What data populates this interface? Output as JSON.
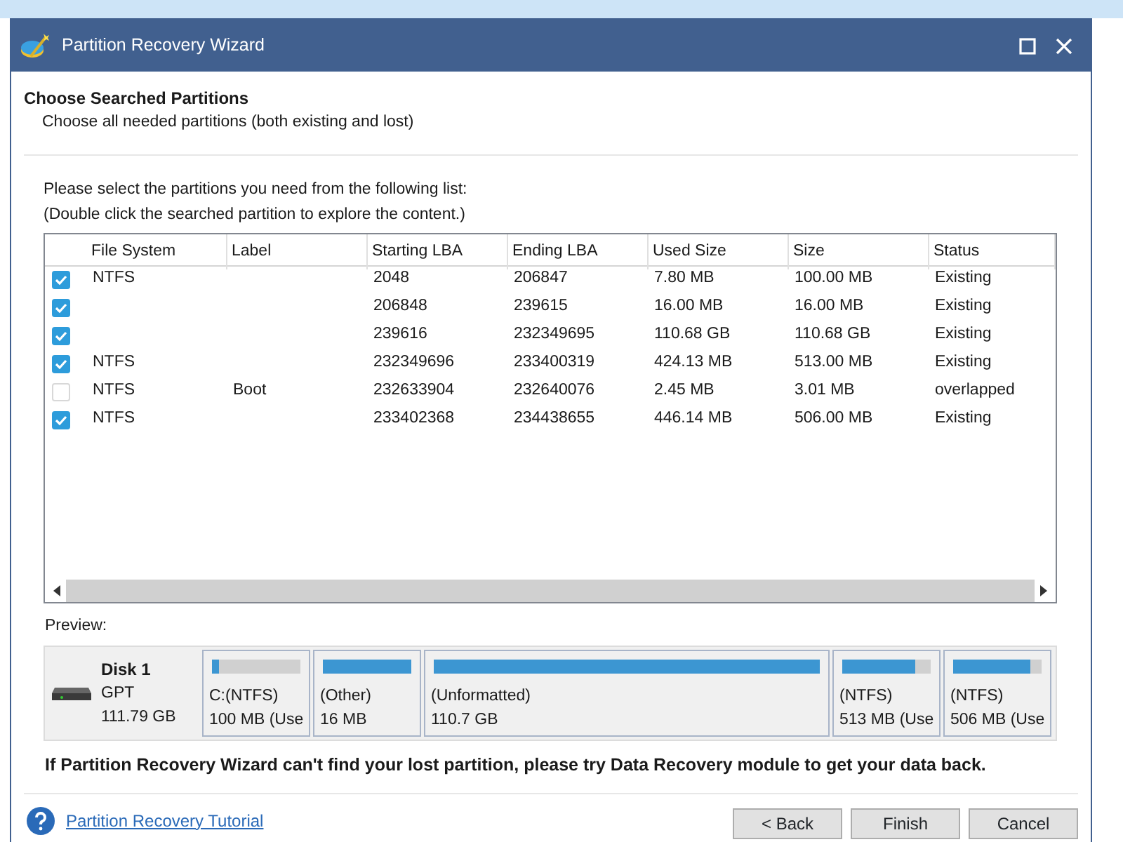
{
  "window": {
    "title": "Partition Recovery Wizard"
  },
  "header": {
    "title": "Choose Searched Partitions",
    "subtitle": "Choose all needed partitions (both existing and lost)"
  },
  "instructions": [
    "Please select the partitions you need from the following list:",
    "(Double click the searched partition to explore the content.)"
  ],
  "table": {
    "columns": [
      "File System",
      "Label",
      "Starting LBA",
      "Ending LBA",
      "Used Size",
      "Size",
      "Status"
    ],
    "rows": [
      {
        "checked": true,
        "cells": [
          "NTFS",
          "",
          "2048",
          "206847",
          "7.80 MB",
          "100.00 MB",
          "Existing"
        ]
      },
      {
        "checked": true,
        "cells": [
          "",
          "",
          "206848",
          "239615",
          "16.00 MB",
          "16.00 MB",
          "Existing"
        ]
      },
      {
        "checked": true,
        "cells": [
          "",
          "",
          "239616",
          "232349695",
          "110.68 GB",
          "110.68 GB",
          "Existing"
        ]
      },
      {
        "checked": true,
        "cells": [
          "NTFS",
          "",
          "232349696",
          "233400319",
          "424.13 MB",
          "513.00 MB",
          "Existing"
        ]
      },
      {
        "checked": false,
        "cells": [
          "NTFS",
          "Boot",
          "232633904",
          "232640076",
          "2.45 MB",
          "3.01 MB",
          "overlapped"
        ]
      },
      {
        "checked": true,
        "cells": [
          "NTFS",
          "",
          "233402368",
          "234438655",
          "446.14 MB",
          "506.00 MB",
          "Existing"
        ]
      }
    ]
  },
  "preview": {
    "label": "Preview:",
    "disk": {
      "name": "Disk 1",
      "type": "GPT",
      "size": "111.79 GB"
    },
    "partitions": [
      {
        "name": "C:(NTFS)",
        "size": "100 MB (Use",
        "level": 0.08
      },
      {
        "name": "(Other)",
        "size": "16 MB",
        "level": 1
      },
      {
        "name": "(Unformatted)",
        "size": "110.7 GB",
        "level": 1
      },
      {
        "name": "(NTFS)",
        "size": "513 MB (Use",
        "level": 0.82
      },
      {
        "name": "(NTFS)",
        "size": "506 MB (Use",
        "level": 0.88
      }
    ]
  },
  "note": "If Partition Recovery Wizard can't find your lost partition, please try Data Recovery module to get your data back.",
  "footer": {
    "link": "Partition Recovery Tutorial",
    "buttons": [
      "< Back",
      "Finish",
      "Cancel"
    ]
  }
}
